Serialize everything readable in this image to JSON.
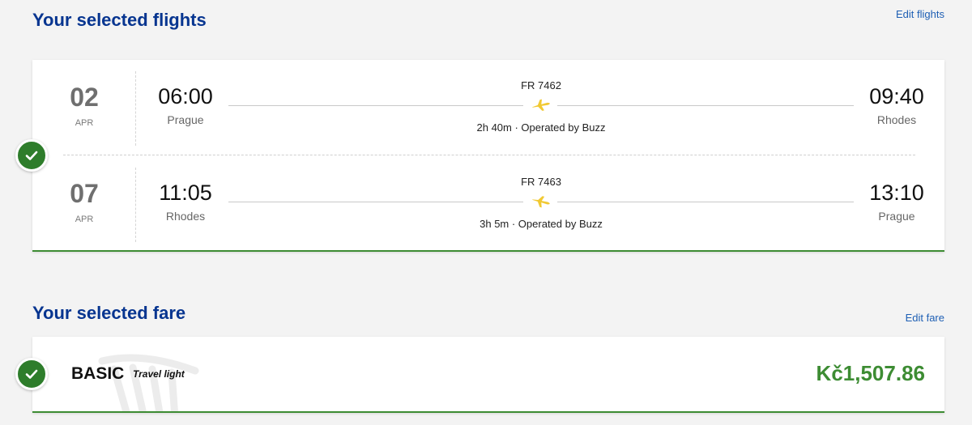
{
  "flights_section": {
    "title": "Your selected flights",
    "edit_label": "Edit flights",
    "segments": [
      {
        "day": "02",
        "month": "APR",
        "departure_time": "06:00",
        "departure_city": "Prague",
        "arrival_time": "09:40",
        "arrival_city": "Rhodes",
        "flight_number": "FR 7462",
        "info": "2h 40m · Operated by Buzz"
      },
      {
        "day": "07",
        "month": "APR",
        "departure_time": "11:05",
        "departure_city": "Rhodes",
        "arrival_time": "13:10",
        "arrival_city": "Prague",
        "flight_number": "FR 7463",
        "info": "3h 5m · Operated by Buzz"
      }
    ]
  },
  "fare_section": {
    "title": "Your selected fare",
    "edit_label": "Edit fare",
    "fare_name": "BASIC",
    "fare_subtitle": "Travel light",
    "price": "Kč1,507.86"
  },
  "icons": {
    "check": "check-icon",
    "plane_outbound": "plane-takeoff-icon",
    "plane_return": "plane-landing-icon",
    "fare_logo": "harp-logo-icon"
  },
  "colors": {
    "title": "#073590",
    "link": "#1e5fb4",
    "accent_green": "#3d8c33",
    "plane_yellow": "#f1c933"
  }
}
